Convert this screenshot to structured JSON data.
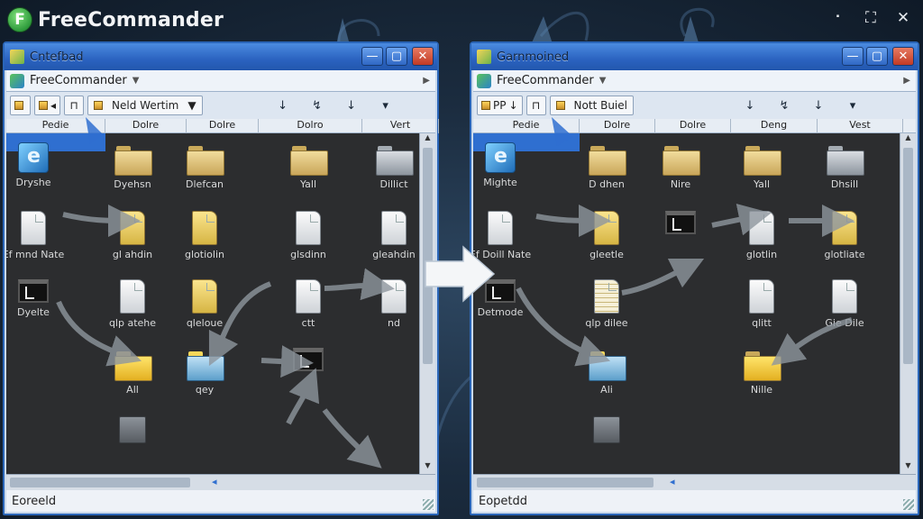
{
  "app": {
    "name": "FreeCommander",
    "logo_letter": "F",
    "controls": {
      "restore": "⛶",
      "close": "✕",
      "menu": "⠂"
    }
  },
  "panels": [
    {
      "id": "left",
      "window_title": "Cntefbad",
      "address": "FreeCommander",
      "toolbar": {
        "buttons": [
          "",
          "",
          "◂",
          "⊓"
        ],
        "combo": "Neld   Wertim",
        "arrows": [
          "↓",
          "↯",
          "↓",
          "▾"
        ]
      },
      "columns": [
        "Pedie",
        "Dolre",
        "Dolre",
        "Dolro",
        "Vert"
      ],
      "status": "Eoreeld",
      "items": [
        {
          "kind": "ie",
          "label": "Dryshe",
          "col": 0,
          "row": 0
        },
        {
          "kind": "folder",
          "label": "Dyehsn",
          "col": 1,
          "row": 0
        },
        {
          "kind": "folder",
          "label": "Dlefcan",
          "col": 2,
          "row": 0
        },
        {
          "kind": "folder",
          "label": "Yall",
          "col": 3,
          "row": 0
        },
        {
          "kind": "folder gray",
          "label": "Dillict",
          "col": 4,
          "row": 0
        },
        {
          "kind": "doc",
          "label": "Ef mnd Nate",
          "col": 0,
          "row": 1
        },
        {
          "kind": "doc yellow",
          "label": "gl ahdin",
          "col": 1,
          "row": 1
        },
        {
          "kind": "doc yellow",
          "label": "glotiolin",
          "col": 2,
          "row": 1
        },
        {
          "kind": "doc",
          "label": "glsdinn",
          "col": 3,
          "row": 1
        },
        {
          "kind": "doc",
          "label": "gleahdin",
          "col": 4,
          "row": 1
        },
        {
          "kind": "term",
          "label": "Dyelte",
          "col": 0,
          "row": 2
        },
        {
          "kind": "doc",
          "label": "qlp atehe",
          "col": 1,
          "row": 2
        },
        {
          "kind": "doc yellow",
          "label": "qleloue",
          "col": 2,
          "row": 2
        },
        {
          "kind": "doc",
          "label": "ctt",
          "col": 3,
          "row": 2
        },
        {
          "kind": "doc",
          "label": "nd",
          "col": 4,
          "row": 2
        },
        {
          "kind": "folder yellow",
          "label": "All",
          "col": 1,
          "row": 3
        },
        {
          "kind": "folder blue",
          "label": "qey",
          "col": 2,
          "row": 3
        },
        {
          "kind": "term",
          "label": "",
          "col": 3,
          "row": 3
        },
        {
          "kind": "drive",
          "label": "",
          "col": 1,
          "row": 4
        },
        {
          "kind": "drive",
          "label": "",
          "col": 1,
          "row": 5
        }
      ]
    },
    {
      "id": "right",
      "window_title": "Garnmoined",
      "address": "FreeCommander",
      "toolbar": {
        "buttons": [
          "PP",
          "↓",
          "⊓"
        ],
        "combo": "Nott   Buiel",
        "arrows": [
          "↓",
          "↯",
          "↓",
          "▾"
        ]
      },
      "columns": [
        "Pedie",
        "Dolre",
        "Dolre",
        "Deng",
        "Vest"
      ],
      "status": "Eopetdd",
      "items": [
        {
          "kind": "ie",
          "label": "Mighte",
          "col": 0,
          "row": 0
        },
        {
          "kind": "folder",
          "label": "D dhen",
          "col": 1,
          "row": 0
        },
        {
          "kind": "folder",
          "label": "Nire",
          "col": 2,
          "row": 0
        },
        {
          "kind": "folder",
          "label": "Yall",
          "col": 3,
          "row": 0
        },
        {
          "kind": "folder gray",
          "label": "Dhsill",
          "col": 4,
          "row": 0
        },
        {
          "kind": "doc",
          "label": "Ef Doill Nate",
          "col": 0,
          "row": 1
        },
        {
          "kind": "doc yellow",
          "label": "gleetle",
          "col": 1,
          "row": 1
        },
        {
          "kind": "term",
          "label": "",
          "col": 2,
          "row": 1
        },
        {
          "kind": "doc",
          "label": "glotlin",
          "col": 3,
          "row": 1
        },
        {
          "kind": "doc yellow",
          "label": "glotliate",
          "col": 4,
          "row": 1
        },
        {
          "kind": "term",
          "label": "Detmode",
          "col": 0,
          "row": 2
        },
        {
          "kind": "doc lines",
          "label": "qlp dilee",
          "col": 1,
          "row": 2
        },
        {
          "kind": "doc",
          "label": "qlitt",
          "col": 3,
          "row": 2
        },
        {
          "kind": "doc",
          "label": "Gie Dile",
          "col": 4,
          "row": 2
        },
        {
          "kind": "folder blue",
          "label": "Ali",
          "col": 1,
          "row": 3
        },
        {
          "kind": "folder yellow",
          "label": "Nille",
          "col": 3,
          "row": 3
        },
        {
          "kind": "drive",
          "label": "",
          "col": 1,
          "row": 4
        },
        {
          "kind": "drive",
          "label": "",
          "col": 1,
          "row": 5
        }
      ]
    }
  ],
  "colors": {
    "accent": "#2a65b7",
    "selection": "#2f6fd0",
    "content_bg": "#2c2d2f"
  }
}
